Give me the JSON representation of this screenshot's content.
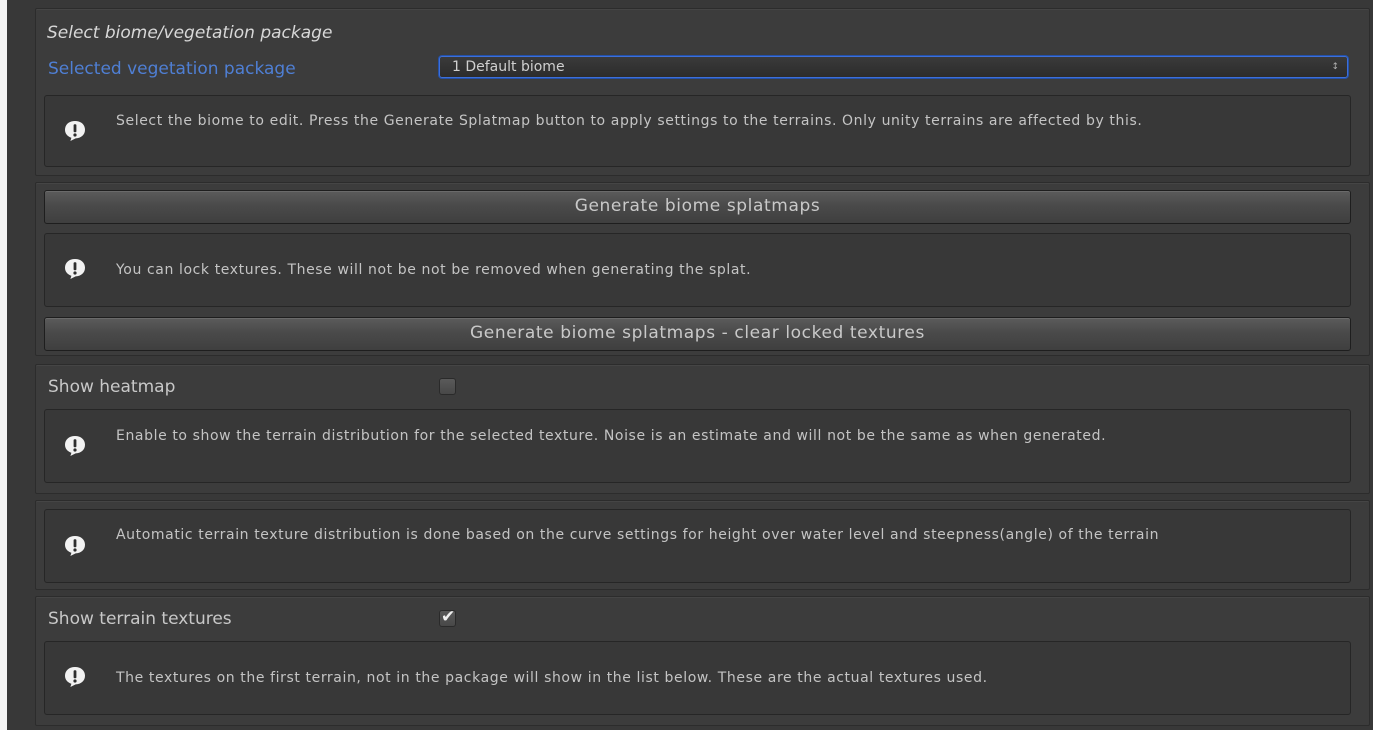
{
  "section_title": "Select biome/vegetation package",
  "vegetation_package": {
    "label": "Selected vegetation package",
    "selected": "1 Default biome",
    "arrow": "↕"
  },
  "help_select": "Select the biome to edit. Press the Generate Splatmap button to apply settings to the terrains. Only unity terrains are affected by this.",
  "generate_button": "Generate biome splatmaps",
  "help_lock": "You can lock textures. These will not be not be removed when generating the splat.",
  "generate_clear_button": "Generate biome splatmaps - clear locked textures",
  "heatmap": {
    "label": "Show heatmap",
    "checked": false
  },
  "help_heatmap": "Enable to show the terrain distribution for the selected texture. Noise is an estimate and will not be the same as when generated.",
  "help_automatic": "Automatic terrain texture distribution is done based on the curve settings for height over water level and steepness(angle) of the terrain",
  "terrain_textures": {
    "label": "Show terrain textures",
    "checked": true,
    "checkmark": "✔"
  },
  "help_textures": "The textures on the first terrain, not in the package will show in the list below. These are the actual textures used.",
  "icons": {
    "help": "info-exclamation-icon"
  }
}
